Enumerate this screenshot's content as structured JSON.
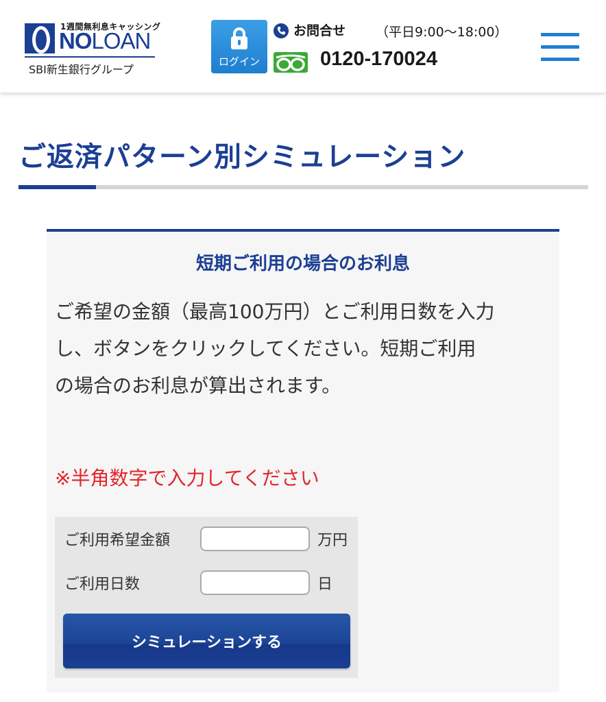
{
  "header": {
    "logo": {
      "tagline": "1週間無利息キャッシング",
      "wordmark_no": "NO",
      "wordmark_loan": "LOAN",
      "group": "SBI新生銀行グループ"
    },
    "login_label": "ログイン",
    "contact": {
      "title": "お問合せ",
      "hours": "（平日9:00〜18:00）",
      "phone": "0120-170024"
    },
    "icons": [
      "lock-icon",
      "phone-icon",
      "freedial-icon",
      "hamburger-menu-icon"
    ]
  },
  "page": {
    "title": "ご返済パターン別シミュレーション"
  },
  "panel": {
    "heading": "短期ご利用の場合のお利息",
    "description_lines": [
      "ご希望の金額（最高100万円）とご利用日数を入力",
      "し、ボタンをクリックしてください。短期ご利用",
      "の場合のお利息が算出されます。"
    ],
    "note": "※半角数字で入力してください",
    "form": {
      "amount_label": "ご利用希望金額",
      "amount_value": "",
      "amount_unit": "万円",
      "days_label": "ご利用日数",
      "days_value": "",
      "days_unit": "日",
      "submit_label": "シミュレーションする"
    }
  },
  "colors": {
    "brand_navy": "#1b3f93",
    "accent_blue": "#1f7fd0",
    "note_red": "#e3242b",
    "freedial_green": "#3aa935"
  }
}
